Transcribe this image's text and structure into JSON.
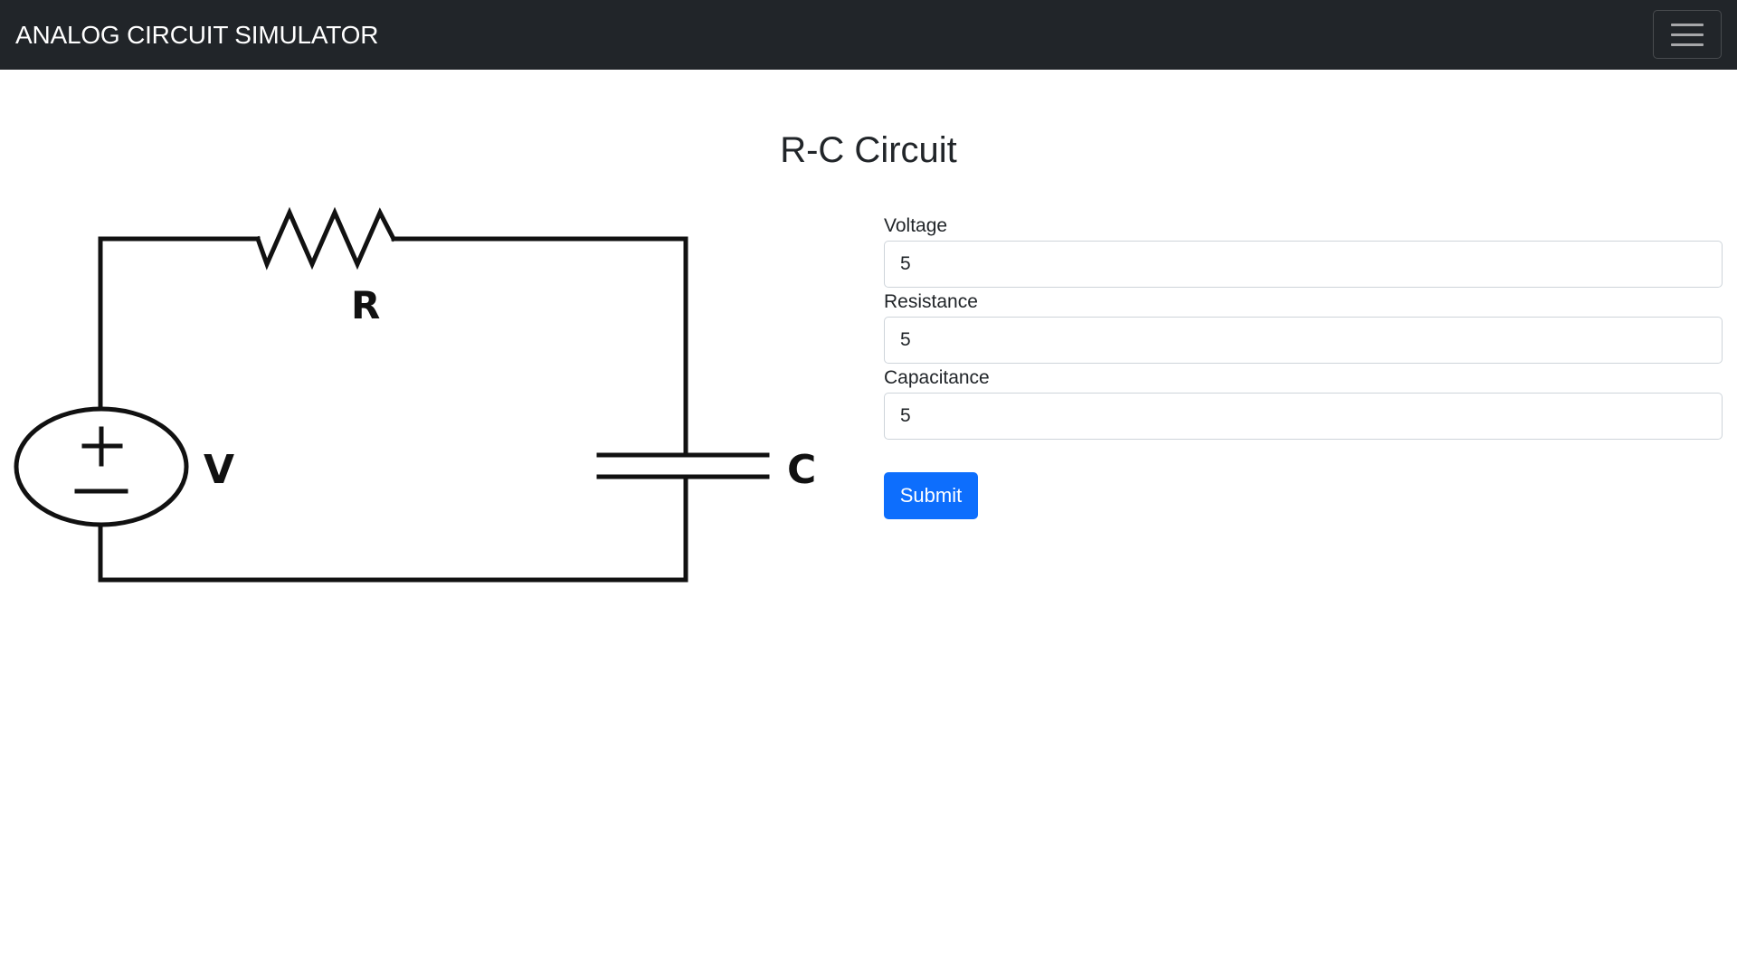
{
  "navbar": {
    "brand": "ANALOG CIRCUIT SIMULATOR",
    "toggler_icon": "hamburger-menu-icon",
    "background": "#212529"
  },
  "page": {
    "title": "R-C Circuit"
  },
  "diagram": {
    "resistor_label": "R",
    "voltage_label": "V",
    "capacitor_label": "C",
    "plus_sign": "+",
    "minus_sign": "−"
  },
  "form": {
    "fields": [
      {
        "label": "Voltage",
        "value": "5"
      },
      {
        "label": "Resistance",
        "value": "5"
      },
      {
        "label": "Capacitance",
        "value": "5"
      }
    ],
    "submit_label": "Submit",
    "accent": "#0d6efd"
  }
}
